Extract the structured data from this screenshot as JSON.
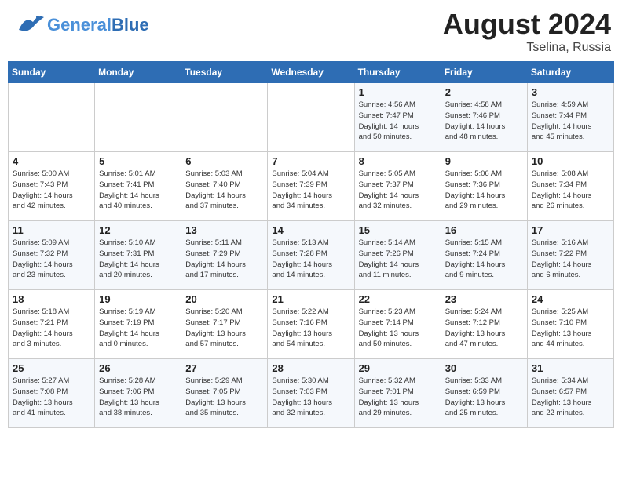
{
  "header": {
    "logo_line1": "General",
    "logo_line2": "Blue",
    "month_year": "August 2024",
    "location": "Tselina, Russia"
  },
  "weekdays": [
    "Sunday",
    "Monday",
    "Tuesday",
    "Wednesday",
    "Thursday",
    "Friday",
    "Saturday"
  ],
  "weeks": [
    [
      {
        "day": "",
        "info": ""
      },
      {
        "day": "",
        "info": ""
      },
      {
        "day": "",
        "info": ""
      },
      {
        "day": "",
        "info": ""
      },
      {
        "day": "1",
        "info": "Sunrise: 4:56 AM\nSunset: 7:47 PM\nDaylight: 14 hours\nand 50 minutes."
      },
      {
        "day": "2",
        "info": "Sunrise: 4:58 AM\nSunset: 7:46 PM\nDaylight: 14 hours\nand 48 minutes."
      },
      {
        "day": "3",
        "info": "Sunrise: 4:59 AM\nSunset: 7:44 PM\nDaylight: 14 hours\nand 45 minutes."
      }
    ],
    [
      {
        "day": "4",
        "info": "Sunrise: 5:00 AM\nSunset: 7:43 PM\nDaylight: 14 hours\nand 42 minutes."
      },
      {
        "day": "5",
        "info": "Sunrise: 5:01 AM\nSunset: 7:41 PM\nDaylight: 14 hours\nand 40 minutes."
      },
      {
        "day": "6",
        "info": "Sunrise: 5:03 AM\nSunset: 7:40 PM\nDaylight: 14 hours\nand 37 minutes."
      },
      {
        "day": "7",
        "info": "Sunrise: 5:04 AM\nSunset: 7:39 PM\nDaylight: 14 hours\nand 34 minutes."
      },
      {
        "day": "8",
        "info": "Sunrise: 5:05 AM\nSunset: 7:37 PM\nDaylight: 14 hours\nand 32 minutes."
      },
      {
        "day": "9",
        "info": "Sunrise: 5:06 AM\nSunset: 7:36 PM\nDaylight: 14 hours\nand 29 minutes."
      },
      {
        "day": "10",
        "info": "Sunrise: 5:08 AM\nSunset: 7:34 PM\nDaylight: 14 hours\nand 26 minutes."
      }
    ],
    [
      {
        "day": "11",
        "info": "Sunrise: 5:09 AM\nSunset: 7:32 PM\nDaylight: 14 hours\nand 23 minutes."
      },
      {
        "day": "12",
        "info": "Sunrise: 5:10 AM\nSunset: 7:31 PM\nDaylight: 14 hours\nand 20 minutes."
      },
      {
        "day": "13",
        "info": "Sunrise: 5:11 AM\nSunset: 7:29 PM\nDaylight: 14 hours\nand 17 minutes."
      },
      {
        "day": "14",
        "info": "Sunrise: 5:13 AM\nSunset: 7:28 PM\nDaylight: 14 hours\nand 14 minutes."
      },
      {
        "day": "15",
        "info": "Sunrise: 5:14 AM\nSunset: 7:26 PM\nDaylight: 14 hours\nand 11 minutes."
      },
      {
        "day": "16",
        "info": "Sunrise: 5:15 AM\nSunset: 7:24 PM\nDaylight: 14 hours\nand 9 minutes."
      },
      {
        "day": "17",
        "info": "Sunrise: 5:16 AM\nSunset: 7:22 PM\nDaylight: 14 hours\nand 6 minutes."
      }
    ],
    [
      {
        "day": "18",
        "info": "Sunrise: 5:18 AM\nSunset: 7:21 PM\nDaylight: 14 hours\nand 3 minutes."
      },
      {
        "day": "19",
        "info": "Sunrise: 5:19 AM\nSunset: 7:19 PM\nDaylight: 14 hours\nand 0 minutes."
      },
      {
        "day": "20",
        "info": "Sunrise: 5:20 AM\nSunset: 7:17 PM\nDaylight: 13 hours\nand 57 minutes."
      },
      {
        "day": "21",
        "info": "Sunrise: 5:22 AM\nSunset: 7:16 PM\nDaylight: 13 hours\nand 54 minutes."
      },
      {
        "day": "22",
        "info": "Sunrise: 5:23 AM\nSunset: 7:14 PM\nDaylight: 13 hours\nand 50 minutes."
      },
      {
        "day": "23",
        "info": "Sunrise: 5:24 AM\nSunset: 7:12 PM\nDaylight: 13 hours\nand 47 minutes."
      },
      {
        "day": "24",
        "info": "Sunrise: 5:25 AM\nSunset: 7:10 PM\nDaylight: 13 hours\nand 44 minutes."
      }
    ],
    [
      {
        "day": "25",
        "info": "Sunrise: 5:27 AM\nSunset: 7:08 PM\nDaylight: 13 hours\nand 41 minutes."
      },
      {
        "day": "26",
        "info": "Sunrise: 5:28 AM\nSunset: 7:06 PM\nDaylight: 13 hours\nand 38 minutes."
      },
      {
        "day": "27",
        "info": "Sunrise: 5:29 AM\nSunset: 7:05 PM\nDaylight: 13 hours\nand 35 minutes."
      },
      {
        "day": "28",
        "info": "Sunrise: 5:30 AM\nSunset: 7:03 PM\nDaylight: 13 hours\nand 32 minutes."
      },
      {
        "day": "29",
        "info": "Sunrise: 5:32 AM\nSunset: 7:01 PM\nDaylight: 13 hours\nand 29 minutes."
      },
      {
        "day": "30",
        "info": "Sunrise: 5:33 AM\nSunset: 6:59 PM\nDaylight: 13 hours\nand 25 minutes."
      },
      {
        "day": "31",
        "info": "Sunrise: 5:34 AM\nSunset: 6:57 PM\nDaylight: 13 hours\nand 22 minutes."
      }
    ]
  ]
}
